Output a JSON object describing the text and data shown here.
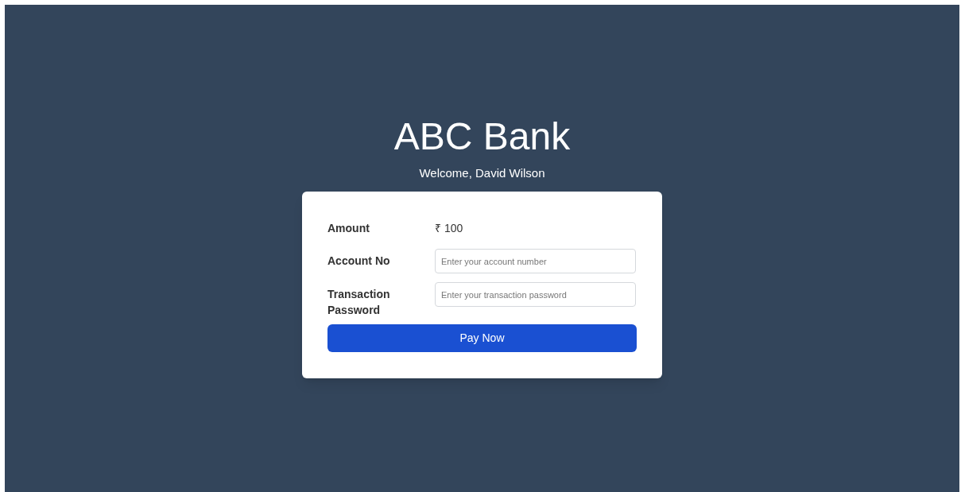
{
  "header": {
    "title": "ABC Bank",
    "welcome": "Welcome, David Wilson"
  },
  "form": {
    "amount": {
      "label": "Amount",
      "value": "₹ 100"
    },
    "fields": [
      {
        "label": "Account No",
        "placeholder": "Enter your account number"
      },
      {
        "label": "Transaction Password",
        "placeholder": "Enter your transaction password"
      }
    ],
    "button": "Pay Now"
  }
}
